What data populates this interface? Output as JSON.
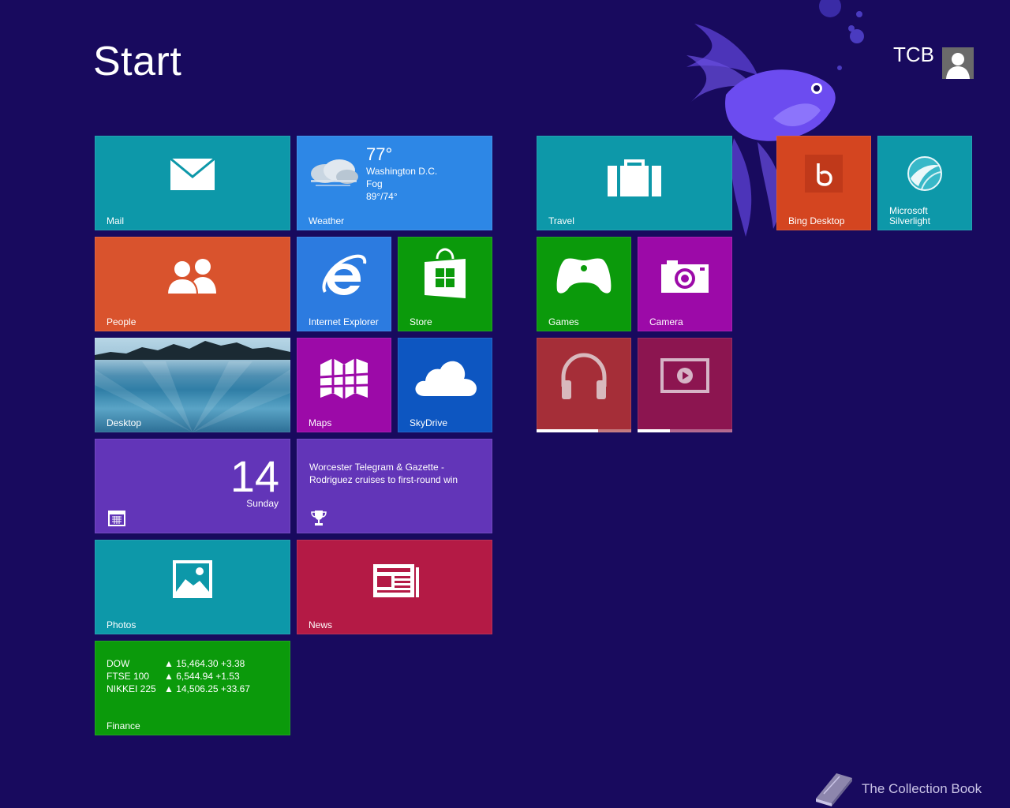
{
  "header": {
    "title": "Start",
    "user_name": "TCB"
  },
  "colors": {
    "background": "#180a5e",
    "teal": "#0d98a9",
    "orange": "#d9532d",
    "blue": "#2d87e6",
    "ie_blue": "#2c7be0",
    "green": "#0b9a0b",
    "magenta": "#9c0aa8",
    "sky_blue": "#0d56c1",
    "purple": "#6235b8",
    "news_red": "#b41a45",
    "music_red": "#a52e38",
    "video_maroon": "#8c1550",
    "bing_orange": "#d44520"
  },
  "tiles": {
    "mail": {
      "label": "Mail",
      "icon": "envelope-icon"
    },
    "weather": {
      "label": "Weather",
      "icon": "cloud-fog-icon",
      "temperature": "77°",
      "city": "Washington D.C.",
      "condition": "Fog",
      "range": "89°/74°"
    },
    "people": {
      "label": "People",
      "icon": "people-icon"
    },
    "internet_explorer": {
      "label": "Internet Explorer",
      "icon": "ie-logo-icon"
    },
    "store": {
      "label": "Store",
      "icon": "store-bag-icon"
    },
    "desktop": {
      "label": "Desktop"
    },
    "maps": {
      "label": "Maps",
      "icon": "map-icon"
    },
    "skydrive": {
      "label": "SkyDrive",
      "icon": "cloud-icon"
    },
    "calendar": {
      "day": "14",
      "weekday": "Sunday",
      "icon": "calendar-icon"
    },
    "sports": {
      "headline": "Worcester Telegram & Gazette - Rodriguez cruises to first-round win",
      "icon": "trophy-icon"
    },
    "photos": {
      "label": "Photos",
      "icon": "photo-icon"
    },
    "news": {
      "label": "News",
      "icon": "newspaper-icon"
    },
    "finance": {
      "label": "Finance",
      "rows": [
        {
          "name": "DOW",
          "value": "▲ 15,464.30 +3.38"
        },
        {
          "name": "FTSE 100",
          "value": "▲ 6,544.94 +1.53"
        },
        {
          "name": "NIKKEI 225",
          "value": "▲ 14,506.25 +33.67"
        }
      ]
    },
    "travel": {
      "label": "Travel",
      "icon": "suitcase-icon"
    },
    "games": {
      "label": "Games",
      "icon": "xbox-controller-icon"
    },
    "camera": {
      "label": "Camera",
      "icon": "camera-icon"
    },
    "music": {
      "icon": "headphones-icon",
      "progress": 0.65
    },
    "video": {
      "icon": "video-play-icon",
      "progress": 0.34
    },
    "bing_desktop": {
      "label": "Bing Desktop",
      "icon": "bing-logo-icon"
    },
    "silverlight": {
      "label": "Microsoft Silverlight",
      "icon": "silverlight-logo-icon"
    }
  },
  "watermark": {
    "text": "The Collection Book",
    "icon": "book-icon"
  }
}
